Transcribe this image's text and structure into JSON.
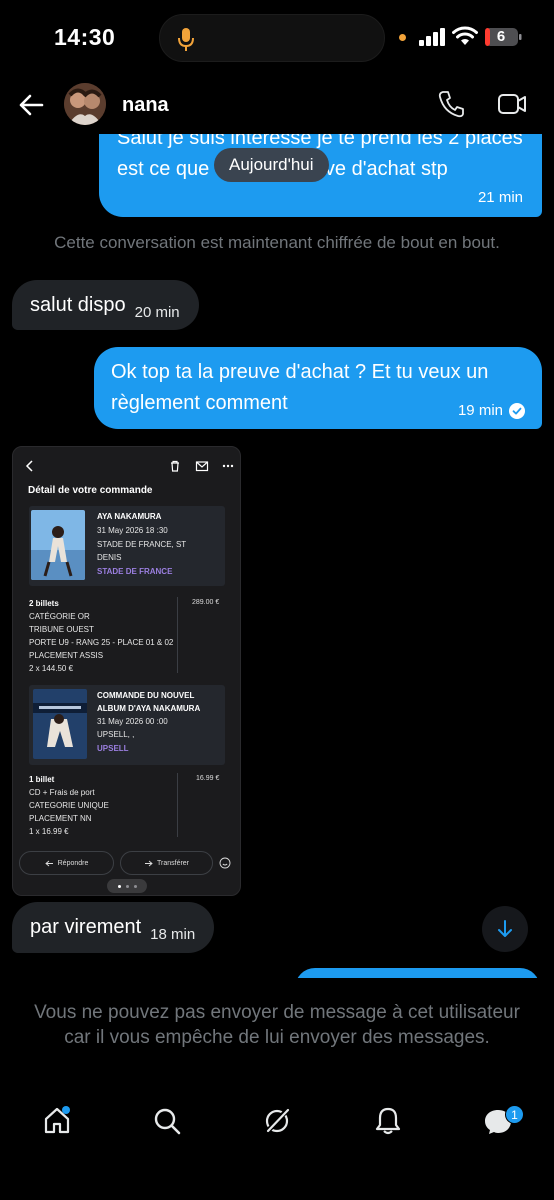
{
  "status": {
    "time": "14:30",
    "battery": "6"
  },
  "header": {
    "contact_name": "nana"
  },
  "messages": [
    {
      "from": "me",
      "text": "Salut je suis intéressé je te prend les 2 places est ce que tu as la preuve d'achat stp",
      "time": "21 min"
    },
    {
      "from": "them",
      "text": "salut dispo",
      "time": "20 min"
    },
    {
      "from": "me",
      "text": "Ok top ta la preuve d'achat ? Et tu veux un règlement comment",
      "time": "19 min"
    },
    {
      "from": "them",
      "text": "par virement",
      "time": "18 min"
    }
  ],
  "date_divider": "Aujourd'hui",
  "system_note": "Cette conversation est maintenant chiffrée de bout en bout.",
  "attachment": {
    "heading": "Détail de votre commande",
    "order1": {
      "artist": "AYA NAKAMURA",
      "date": "31 May 2026 18 :30",
      "venue_line1": "STADE DE FRANCE, ST",
      "venue_line2": "DENIS",
      "venue_tag": "STADE DE FRANCE",
      "qty": "2 billets",
      "price": "289.00 €",
      "cat": "CATÉGORIE OR",
      "tribune": "TRIBUNE OUEST",
      "seat": "PORTE U9 - RANG 25 - PLACE 01 & 02",
      "placement": "PLACEMENT ASSIS",
      "unit": "2 x 144.50 €"
    },
    "order2": {
      "title1": "COMMANDE DU NOUVEL",
      "title2": "ALBUM D'AYA NAKAMURA",
      "date": "31 May 2026 00 :00",
      "line": "UPSELL, ,",
      "tag": "UPSELL",
      "qty": "1 billet",
      "price": "16.99 €",
      "item": "CD + Frais de port",
      "cat": "CATEGORIE UNIQUE",
      "placement": "PLACEMENT NN",
      "unit": "1 x 16.99 €"
    },
    "reply_label": "Répondre",
    "forward_label": "Transférer"
  },
  "blocked_note": "Vous ne pouvez pas envoyer de message à cet utilisateur car il vous empêche de lui envoyer des messages.",
  "nav": {
    "messages_badge": "1"
  },
  "colors": {
    "accent": "#1d9bf0",
    "incoming": "#202327",
    "muted": "#71767b",
    "purple": "#9b7fe0"
  }
}
